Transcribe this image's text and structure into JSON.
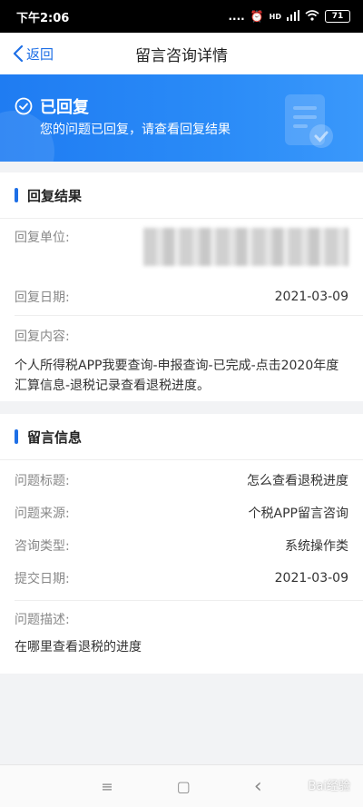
{
  "status_bar": {
    "time": "下午2:06",
    "signal_text": "....",
    "hd_text": "HD",
    "battery": "71"
  },
  "nav": {
    "back_label": "返回",
    "title": "留言咨询详情"
  },
  "banner": {
    "status": "已回复",
    "subtitle": "您的问题已回复，请查看回复结果"
  },
  "reply": {
    "section_title": "回复结果",
    "unit_label": "回复单位:",
    "date_label": "回复日期:",
    "date_value": "2021-03-09",
    "content_label": "回复内容:",
    "content_value": "个人所得税APP我要查询-申报查询-已完成-点击2020年度汇算信息-退税记录查看退税进度。"
  },
  "message": {
    "section_title": "留言信息",
    "rows": [
      {
        "label": "问题标题:",
        "value": "怎么查看退税进度"
      },
      {
        "label": "问题来源:",
        "value": "个税APP留言咨询"
      },
      {
        "label": "咨询类型:",
        "value": "系统操作类"
      },
      {
        "label": "提交日期:",
        "value": "2021-03-09"
      }
    ],
    "desc_label": "问题描述:",
    "desc_value": "在哪里查看退税的进度"
  },
  "system_nav": {
    "menu_glyph": "≡",
    "home_glyph": "▢",
    "back_glyph": "‹"
  },
  "watermark": "Bai经验",
  "colors": {
    "accent": "#1e6fe6",
    "banner": "#2a8bf7"
  }
}
